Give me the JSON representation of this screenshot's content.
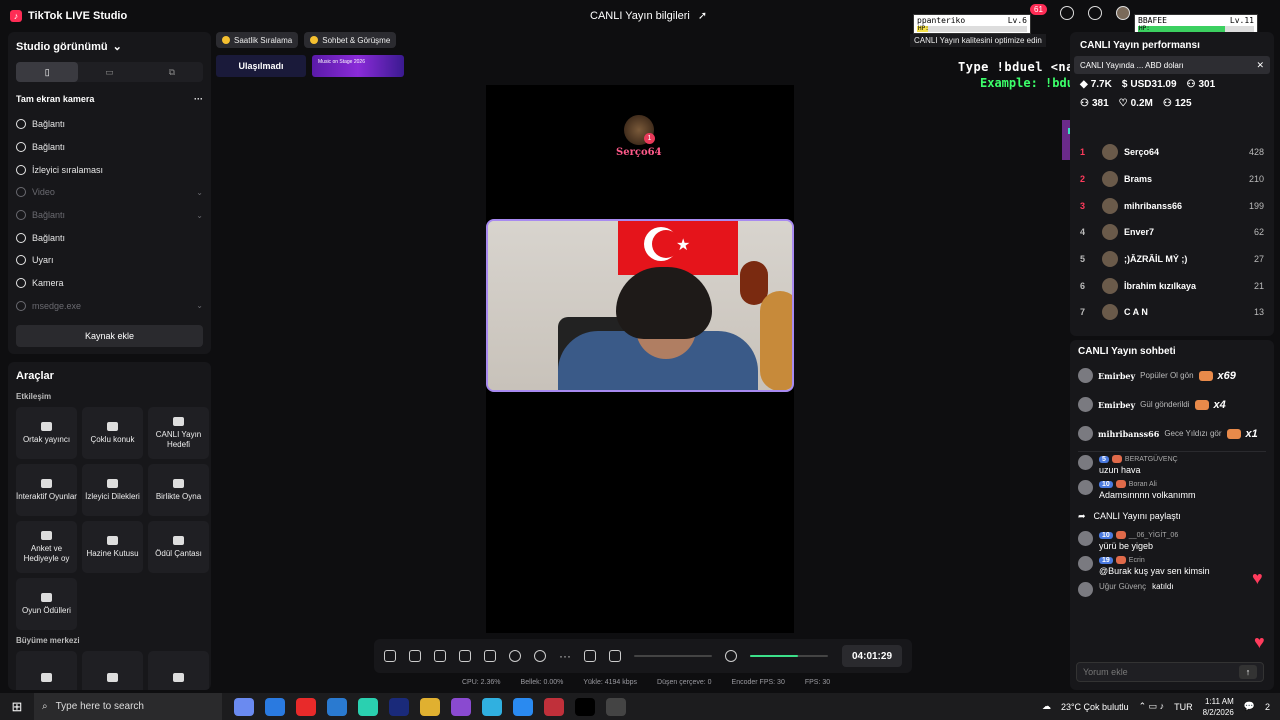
{
  "titlebar": {
    "app_name": "TikTok LIVE Studio",
    "stream_info": "CANLI Yayın bilgileri",
    "notif_count": "61"
  },
  "studio": {
    "title": "Studio görünümü",
    "scene": "Tam ekran kamera",
    "sources": [
      {
        "label": "Bağlantı",
        "dim": false,
        "chevron": false
      },
      {
        "label": "Bağlantı",
        "dim": false,
        "chevron": false
      },
      {
        "label": "İzleyici sıralaması",
        "dim": false,
        "chevron": false
      },
      {
        "label": "Video",
        "dim": true,
        "chevron": true
      },
      {
        "label": "Bağlantı",
        "dim": true,
        "chevron": true
      },
      {
        "label": "Bağlantı",
        "dim": false,
        "chevron": false
      },
      {
        "label": "Uyarı",
        "dim": false,
        "chevron": false
      },
      {
        "label": "Kamera",
        "dim": false,
        "chevron": false
      },
      {
        "label": "msedge.exe",
        "dim": true,
        "chevron": true
      }
    ],
    "add_source": "Kaynak ekle"
  },
  "tools": {
    "title": "Araçlar",
    "section1": "Etkileşim",
    "items": [
      {
        "label": "Ortak yayıncı",
        "icon": "co-host-icon"
      },
      {
        "label": "Çoklu konuk",
        "icon": "multi-guest-icon"
      },
      {
        "label": "CANLI Yayın Hedefi",
        "icon": "live-goal-icon"
      },
      {
        "label": "İnteraktif Oyunlar",
        "icon": "gamepad-icon"
      },
      {
        "label": "İzleyici Dilekleri",
        "icon": "gift-icon"
      },
      {
        "label": "Birlikte Oyna",
        "icon": "play-together-icon"
      },
      {
        "label": "Anket ve Hediyeyle oy",
        "icon": "poll-icon"
      },
      {
        "label": "Hazine Kutusu",
        "icon": "treasure-box-icon"
      },
      {
        "label": "Ödül Çantası",
        "icon": "reward-bag-icon"
      },
      {
        "label": "Oyun Ödülleri",
        "icon": "game-reward-icon"
      }
    ],
    "section2": "Büyüme merkezi"
  },
  "center": {
    "pill1": "Saatlik Sıralama",
    "pill2": "Sohbet & Görüşme",
    "goal": "Ulaşılmadı",
    "banner": "Music on Stage 2026",
    "stage_user": "Serço64",
    "stage_badge": "1",
    "timer": "04:01:29",
    "stats": [
      "CPU:  2.36%",
      "Bellek:  0.00%",
      "Yükle:  4194 kbps",
      "Düşen çerçeve:  0",
      "Encoder FPS:  30",
      "FPS:  30"
    ],
    "mic_level": 0.62
  },
  "game": {
    "type_to_play": "Type !bduel <name> to play",
    "example": "Example: !bduel BBAFEE",
    "player1": {
      "name": "ppanteriko",
      "level": "Lv.6",
      "hp": 0.1
    },
    "player2": {
      "name": "BBAFEE",
      "level": "Lv.11",
      "hp": 0.75
    },
    "hp_label": "HP:"
  },
  "quality_tip": "CANLI Yayın kalitesini optimize edin",
  "performance": {
    "title": "CANLI Yayın performansı",
    "notice": "CANLI Yayında ... ABD doları",
    "metrics": [
      "7.7K",
      "USD31.09",
      "301",
      "381",
      "0.2M",
      "125"
    ],
    "ranking": [
      {
        "rank": "1",
        "name": "Serço64",
        "score": "428",
        "color": "#ff3b5c"
      },
      {
        "rank": "2",
        "name": "Brams",
        "score": "210",
        "color": "#ff3b5c"
      },
      {
        "rank": "3",
        "name": "mihribanss66",
        "score": "199",
        "color": "#ff3b5c"
      },
      {
        "rank": "4",
        "name": "Enver7",
        "score": "62",
        "color": "#bbbbbb"
      },
      {
        "rank": "5",
        "name": ";)ÂZRÂİL MÝ ;)",
        "score": "27",
        "color": "#bbbbbb"
      },
      {
        "rank": "6",
        "name": "İbrahim kızılkaya",
        "score": "21",
        "color": "#bbbbbb"
      },
      {
        "rank": "7",
        "name": "C A N",
        "score": "13",
        "color": "#bbbbbb"
      }
    ]
  },
  "chat": {
    "title": "CANLI Yayın sohbeti",
    "gifts": [
      {
        "user": "Emirbey",
        "text": "Popüler Ol gön",
        "count": "x69"
      },
      {
        "user": "Emirbey",
        "text": "Gül gönderildi",
        "count": "x4"
      },
      {
        "user": "mihribanss66",
        "text": "Gece Yıldızı gör",
        "count": "x1"
      }
    ],
    "messages": [
      {
        "level": "5",
        "user": "BERATGÜVENÇ",
        "text": "uzun hava"
      },
      {
        "level": "10",
        "user": "Boran Ali",
        "text": "Adamsınnnn volkanımm"
      },
      {
        "level": "10",
        "user": "__06_YİGİT_06",
        "text": "yürü be yigeb"
      },
      {
        "level": "19",
        "user": "Ecrin",
        "text": "@Burak kuş yav sen kimsin"
      }
    ],
    "share": "CANLI Yayını paylaştı",
    "join_user": "Uğur Güvenç",
    "join_text": "katıldı",
    "comment_placeholder": "Yorum ekle"
  },
  "taskbar": {
    "search": "Type here to search",
    "weather": "23°C  Çok bulutlu",
    "lang": "TUR",
    "time": "1:11 AM",
    "date": "8/2/2026",
    "notif": "2",
    "app_colors": [
      "#6a8af0",
      "#2a7ae0",
      "#e82a2a",
      "#2a7ad0",
      "#2ad0b0",
      "#1a2a7a",
      "#e0b030",
      "#8a4ad0",
      "#30b0e0",
      "#2a8af0",
      "#c0303a",
      "#000000",
      "#444444"
    ]
  }
}
